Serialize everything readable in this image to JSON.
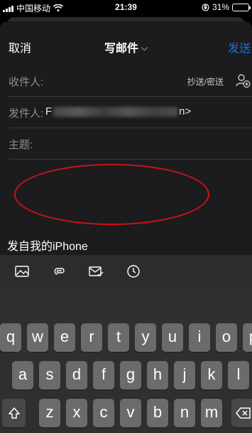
{
  "status_bar": {
    "carrier": "中国移动",
    "time": "21:39",
    "battery_percent": "31%",
    "battery_level": 0.31
  },
  "nav": {
    "cancel_label": "取消",
    "title": "写邮件",
    "send_label": "发送"
  },
  "fields": {
    "to_label": "收件人:",
    "cc_bcc_label": "抄送/密送",
    "from_label": "发件人:",
    "from_value_prefix": "F",
    "from_value_suffix": "n>",
    "subject_label": "主题:"
  },
  "body": {
    "signature": "发自我的iPhone"
  },
  "toolbar": {
    "tools": [
      "image-icon",
      "attachment-icon",
      "mail-check-icon",
      "clock-icon"
    ]
  },
  "keyboard": {
    "row1": [
      "q",
      "w",
      "e",
      "r",
      "t",
      "y",
      "u",
      "i",
      "o",
      "p"
    ],
    "row2": [
      "a",
      "s",
      "d",
      "f",
      "g",
      "h",
      "j",
      "k",
      "l"
    ],
    "row3": [
      "z",
      "x",
      "c",
      "v",
      "b",
      "n",
      "m"
    ]
  }
}
